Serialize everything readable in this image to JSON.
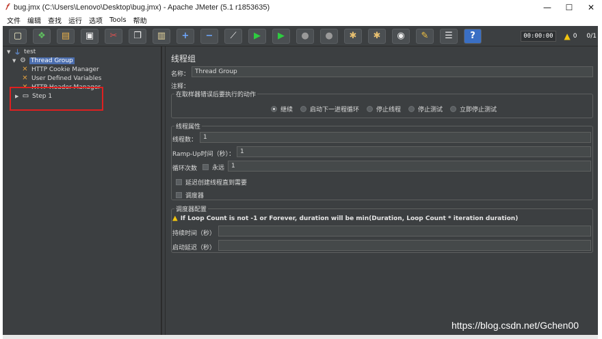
{
  "window": {
    "title": "bug.jmx (C:\\Users\\Lenovo\\Desktop\\bug.jmx) - Apache JMeter (5.1 r1853635)",
    "app_icon": "jmeter-feather-icon",
    "controls": {
      "minimize": "—",
      "maximize": "☐",
      "close": "✕"
    }
  },
  "menu": [
    "文件",
    "编辑",
    "查找",
    "运行",
    "选项",
    "Tools",
    "帮助"
  ],
  "toolbar": {
    "buttons": [
      {
        "name": "new-button",
        "icon": "▢"
      },
      {
        "name": "templates-button",
        "icon": "❖"
      },
      {
        "name": "open-button",
        "icon": "▤"
      },
      {
        "name": "save-button",
        "icon": "▣"
      },
      {
        "name": "cut-button",
        "icon": "✂"
      },
      {
        "name": "copy-button",
        "icon": "❐"
      },
      {
        "name": "paste-button",
        "icon": "▥"
      },
      {
        "name": "expand-button",
        "icon": "+"
      },
      {
        "name": "collapse-button",
        "icon": "−"
      },
      {
        "name": "toggle-button",
        "icon": "⟋"
      },
      {
        "name": "start-button",
        "icon": "▶"
      },
      {
        "name": "start-no-pause-button",
        "icon": "▶"
      },
      {
        "name": "stop-button",
        "icon": "●"
      },
      {
        "name": "shutdown-button",
        "icon": "●"
      },
      {
        "name": "clear-button",
        "icon": "✱"
      },
      {
        "name": "clear-all-button",
        "icon": "✱"
      },
      {
        "name": "search-button",
        "icon": "◉"
      },
      {
        "name": "reset-search-button",
        "icon": "✎"
      },
      {
        "name": "function-helper-button",
        "icon": "☰"
      },
      {
        "name": "help-button",
        "icon": "?"
      }
    ],
    "timer": "00:00:00",
    "warning_count": "0",
    "thread_ratio": "0/1"
  },
  "tree": {
    "nodes": [
      {
        "label": "test",
        "icon": "test-plan-icon",
        "arrow": "▼"
      },
      {
        "label": "Thread Group",
        "icon": "thread-group-gear-icon",
        "arrow": "▼",
        "selected": true
      },
      {
        "label": "HTTP Cookie Manager",
        "icon": "config-element-icon",
        "arrow": ""
      },
      {
        "label": "User Defined Variables",
        "icon": "config-element-icon",
        "arrow": ""
      },
      {
        "label": "HTTP Header Manager",
        "icon": "config-element-icon",
        "arrow": ""
      },
      {
        "label": "Step 1",
        "icon": "transaction-controller-icon",
        "arrow": "▶"
      }
    ]
  },
  "panel": {
    "title": "线程组",
    "name_label": "名称：",
    "name_value": "Thread Group",
    "comment_label": "注释：",
    "comment_value": "",
    "error_action": {
      "title": "在取样器错误后要执行的动作",
      "options": [
        "继续",
        "启动下一进程循环",
        "停止线程",
        "停止测试",
        "立即停止测试"
      ],
      "selected": 0
    },
    "thread_props": {
      "title": "线程属性",
      "threads_label": "线程数：",
      "threads_value": "1",
      "rampup_label": "Ramp-Up时间（秒）：",
      "rampup_value": "1",
      "loop_label": "循环次数",
      "forever_label": "永远",
      "loop_value": "1",
      "delay_label": "延迟创建线程直到需要",
      "scheduler_label": "调度器"
    },
    "scheduler": {
      "title": "调度器配置",
      "warning": "If Loop Count is not -1 or Forever, duration will be min(Duration, Loop Count * iteration duration)",
      "duration_label": "持续时间（秒）",
      "duration_value": "",
      "delay_label": "启动延迟（秒）",
      "delay_value": ""
    }
  },
  "watermark": "https://blog.csdn.net/Gchen00",
  "colors": {
    "background": "#3c3f41",
    "selection": "#4b6eaf",
    "highlight_box": "#e02020",
    "field": "#45494a"
  }
}
